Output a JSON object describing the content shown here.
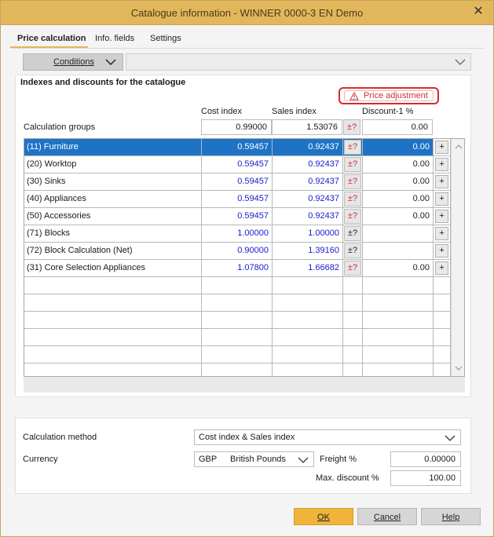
{
  "window": {
    "title": "Catalogue information - WINNER 0000-3 EN Demo",
    "close_symbol": "✕"
  },
  "tabs": [
    {
      "label": "Price calculation",
      "active": true
    },
    {
      "label": "Info. fields",
      "active": false
    },
    {
      "label": "Settings",
      "active": false
    }
  ],
  "conditions": {
    "label": "Conditions",
    "selected_value": ""
  },
  "indexes": {
    "title": "Indexes and discounts for the catalogue",
    "price_adjustment_label": "Price adjustment",
    "col_cost": "Cost index",
    "col_sales": "Sales index",
    "col_discount": "Discount-1 %",
    "calc_groups_label": "Calculation groups",
    "calc_groups_cost": "0.99000",
    "calc_groups_sales": "1.53076",
    "calc_groups_discount": "0.00",
    "pm_symbol": "±?",
    "plus_symbol": "+",
    "rows": [
      {
        "name": "(11) Furniture",
        "cost": "0.59457",
        "sales": "0.92437",
        "discount": "0.00",
        "pm": "red",
        "plus": true,
        "selected": true
      },
      {
        "name": "(20) Worktop",
        "cost": "0.59457",
        "sales": "0.92437",
        "discount": "0.00",
        "pm": "red",
        "plus": true,
        "selected": false
      },
      {
        "name": "(30) Sinks",
        "cost": "0.59457",
        "sales": "0.92437",
        "discount": "0.00",
        "pm": "red",
        "plus": true,
        "selected": false
      },
      {
        "name": "(40) Appliances",
        "cost": "0.59457",
        "sales": "0.92437",
        "discount": "0.00",
        "pm": "red",
        "plus": true,
        "selected": false
      },
      {
        "name": "(50) Accessories",
        "cost": "0.59457",
        "sales": "0.92437",
        "discount": "0.00",
        "pm": "red",
        "plus": true,
        "selected": false
      },
      {
        "name": "(71) Blocks",
        "cost": "1.00000",
        "sales": "1.00000",
        "discount": "",
        "pm": "black",
        "plus": true,
        "selected": false
      },
      {
        "name": "(72) Block Calculation (Net)",
        "cost": "0.90000",
        "sales": "1.39160",
        "discount": "",
        "pm": "black",
        "plus": true,
        "selected": false
      },
      {
        "name": "(31) Core Selection Appliances",
        "cost": "1.07800",
        "sales": "1.66682",
        "discount": "0.00",
        "pm": "red",
        "plus": true,
        "selected": false
      }
    ],
    "empty_rows": 6
  },
  "calculation": {
    "method_label": "Calculation method",
    "method_value": "Cost index & Sales index",
    "currency_label": "Currency",
    "currency_code": "GBP",
    "currency_name": "British Pounds",
    "freight_label": "Freight %",
    "freight_value": "0.00000",
    "max_discount_label": "Max. discount %",
    "max_discount_value": "100.00"
  },
  "buttons": {
    "ok": "OK",
    "cancel": "Cancel",
    "help": "Help"
  },
  "colors": {
    "titlebar": "#e2b75c",
    "selection": "#1e73c6",
    "index_text": "#1a1acf",
    "warning": "#d52a2a",
    "ok_button": "#f0b43b"
  }
}
